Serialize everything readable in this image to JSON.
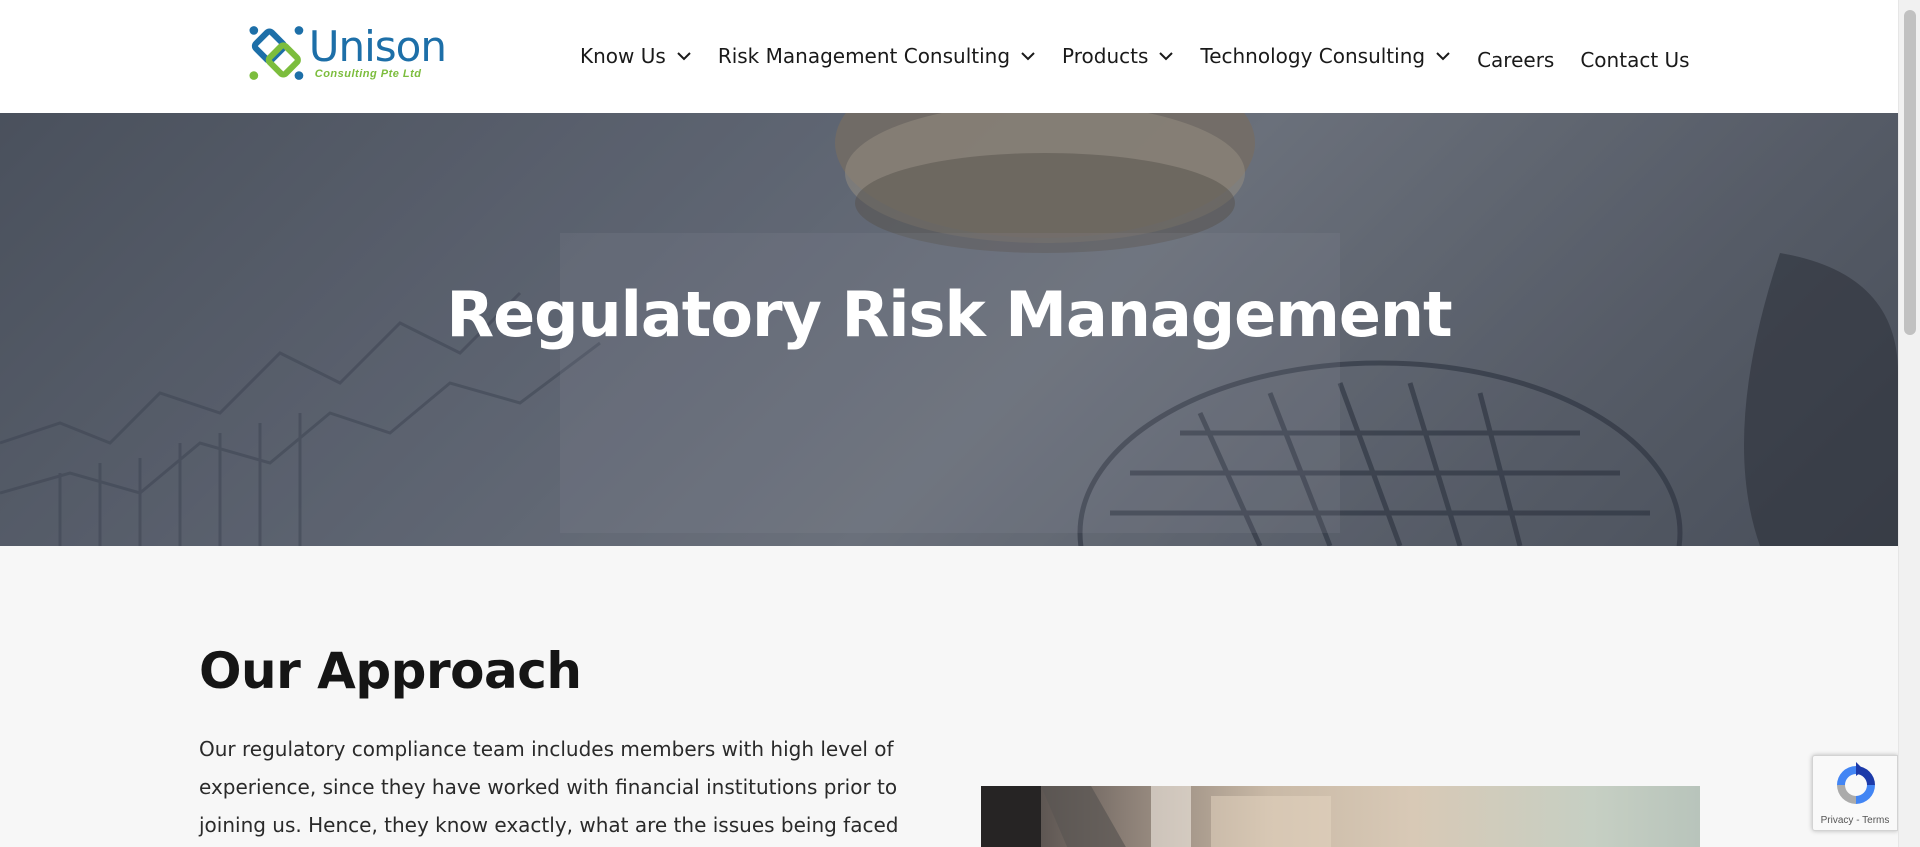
{
  "brand": {
    "name": "Unison",
    "tagline": "Consulting Pte Ltd",
    "primary_color": "#1d6fa8",
    "accent_color": "#7cbd3d"
  },
  "nav": {
    "items": [
      {
        "label": "Know Us",
        "has_dropdown": true,
        "icon": "chevron-down-icon"
      },
      {
        "label": "Risk Management Consulting",
        "has_dropdown": true,
        "icon": "chevron-down-icon"
      },
      {
        "label": "Products",
        "has_dropdown": true,
        "icon": "chevron-down-icon"
      },
      {
        "label": "Technology Consulting",
        "has_dropdown": true,
        "icon": "chevron-down-icon"
      },
      {
        "label": "Careers",
        "has_dropdown": false
      },
      {
        "label": "Contact Us",
        "has_dropdown": false
      }
    ]
  },
  "hero": {
    "title": "Regulatory Risk Management"
  },
  "approach": {
    "title": "Our Approach",
    "text_lines": [
      "Our regulatory compliance team includes members with high level of",
      "experience, since they have worked with financial institutions prior to",
      "joining us. Hence, they know exactly, what are the issues being faced by"
    ]
  },
  "recaptcha": {
    "icon": "recaptcha-icon",
    "links": "Privacy - Terms"
  }
}
